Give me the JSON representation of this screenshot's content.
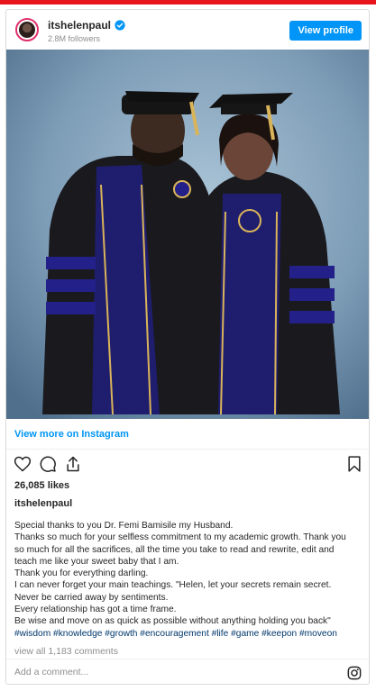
{
  "header": {
    "username": "itshelenpaul",
    "followers": "2.8M followers",
    "view_profile_label": "View profile",
    "verified_icon": "verified-badge-icon",
    "accent_color": "#0095f6"
  },
  "post": {
    "image_icon": "photo",
    "view_more_label": "View more on Instagram",
    "actions": {
      "like_icon": "heart-icon",
      "comment_icon": "comment-icon",
      "share_icon": "share-icon",
      "save_icon": "bookmark-icon"
    },
    "likes": "26,085 likes",
    "author": "itshelenpaul",
    "caption_lines": [
      "Special thanks to you Dr. Femi Bamisile my Husband.",
      "Thanks so much for your selfless commitment to my academic growth. Thank you",
      "so much for all the sacrifices, all the time you take to read and rewrite, edit and",
      "teach me like your sweet baby that I am.",
      "Thank you for everything darling.",
      "I can never forget your main teachings. \"Helen, let your secrets remain secret.",
      "Never be carried away by sentiments.",
      "Every relationship has got a time frame.",
      "Be wise and move on as quick as possible without anything holding you back\""
    ],
    "hashtags": "#wisdom #knowledge #growth #encouragement #life #game #keepon #moveon",
    "view_comments": "view all 1,183 comments",
    "add_comment_placeholder": "Add a comment...",
    "instagram_icon": "instagram-logo-icon"
  }
}
